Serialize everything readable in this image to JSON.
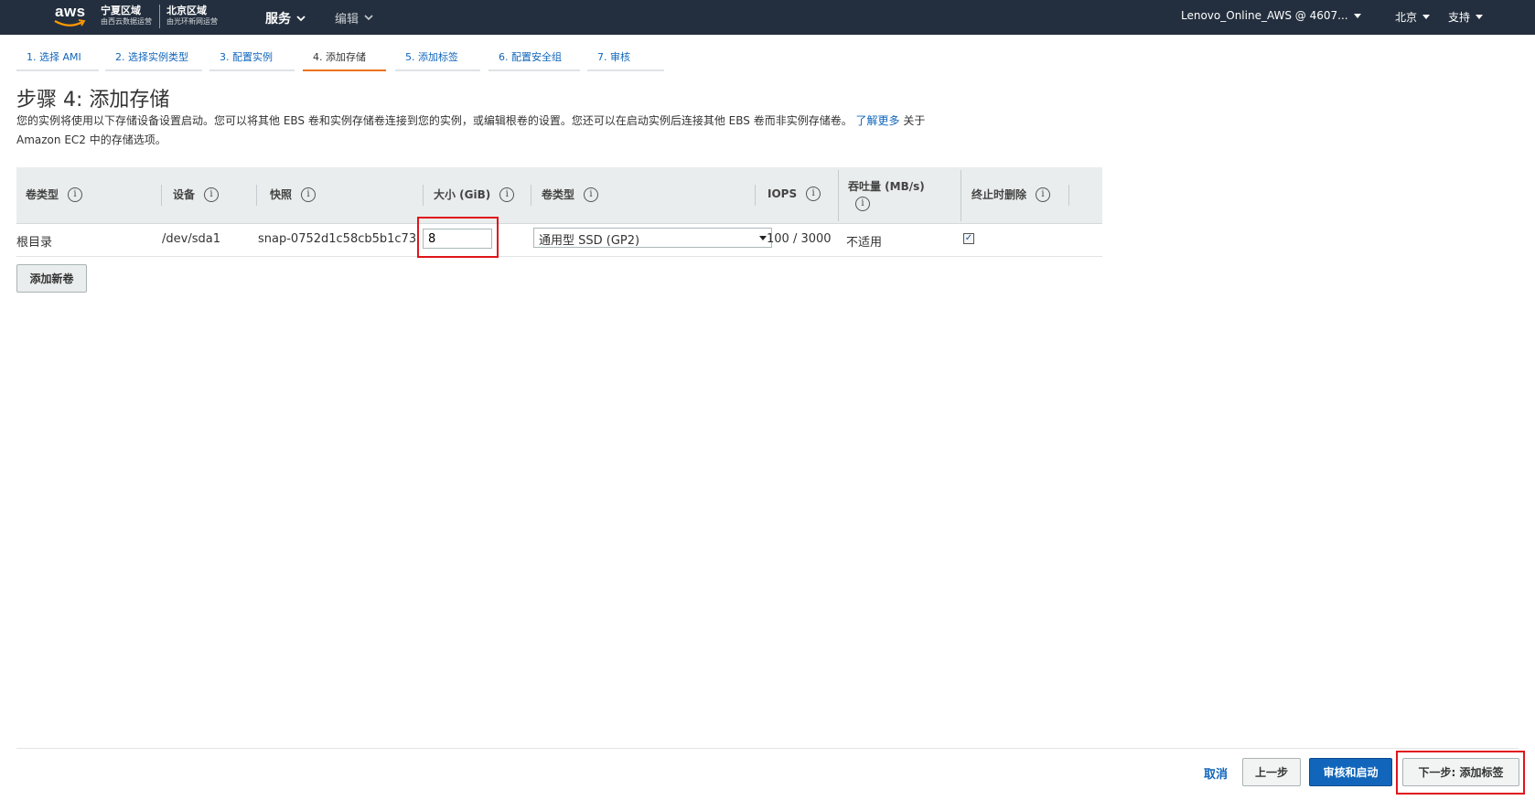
{
  "nav": {
    "logo_text": "aws",
    "region_ningxia": {
      "title": "宁夏区域",
      "subtitle": "由西云数据运营"
    },
    "region_beijing": {
      "title": "北京区域",
      "subtitle": "由光环新网运营"
    },
    "services_label": "服务",
    "edit_label": "编辑",
    "account_label": "Lenovo_Online_AWS @ 4607...",
    "region_label": "北京",
    "support_label": "支持"
  },
  "steps": [
    {
      "label": "1. 选择 AMI",
      "active": false
    },
    {
      "label": "2. 选择实例类型",
      "active": false
    },
    {
      "label": "3. 配置实例",
      "active": false
    },
    {
      "label": "4. 添加存储",
      "active": true
    },
    {
      "label": "5. 添加标签",
      "active": false
    },
    {
      "label": "6. 配置安全组",
      "active": false
    },
    {
      "label": "7. 审核",
      "active": false
    }
  ],
  "page": {
    "title": "步骤 4: 添加存储",
    "description": "您的实例将使用以下存储设备设置启动。您可以将其他 EBS 卷和实例存储卷连接到您的实例，或编辑根卷的设置。您还可以在启动实例后连接其他 EBS 卷而非实例存储卷。",
    "learn_more": "了解更多",
    "description_suffix": " 关于 Amazon EC2 中的存储选项。"
  },
  "table": {
    "headers": {
      "volume_type": "卷类型",
      "device": "设备",
      "snapshot": "快照",
      "size": "大小 (GiB)",
      "ebs_type": "卷类型",
      "iops": "IOPS",
      "throughput": "吞吐量 (MB/s)",
      "delete_on_termination": "终止时删除"
    },
    "info_icon": "i",
    "row": {
      "volume_type": "根目录",
      "device": "/dev/sda1",
      "snapshot": "snap-0752d1c58cb5b1c73",
      "size": "8",
      "ebs_type": "通用型 SSD (GP2)",
      "iops": "100 / 3000",
      "throughput": "不适用",
      "delete_on_termination": true,
      "check_mark": "✓"
    }
  },
  "add_volume_button": "添加新卷",
  "footer": {
    "cancel": "取消",
    "previous": "上一步",
    "review_launch": "审核和启动",
    "next": "下一步: 添加标签"
  },
  "colors": {
    "navbar": "#232f3e",
    "link": "#1166bb",
    "active_step": "#ec7211",
    "highlight": "#e0141b",
    "primary_button": "#1166bb"
  }
}
